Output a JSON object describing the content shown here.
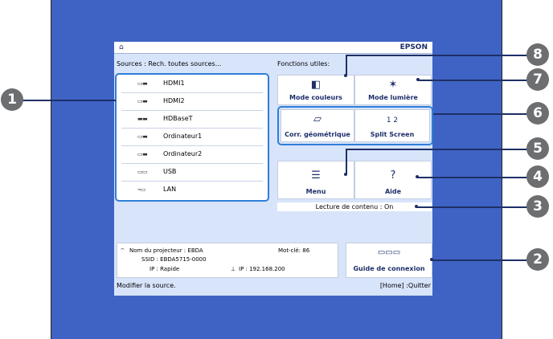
{
  "header": {
    "home_icon": "⌂",
    "brand": "EPSON"
  },
  "sources": {
    "heading": "Sources : Rech. toutes sources...",
    "items": [
      {
        "icon": "▭▬",
        "label": "HDMI1"
      },
      {
        "icon": "▭▬",
        "label": "HDMI2"
      },
      {
        "icon": "▬▬",
        "label": "HDBaseT"
      },
      {
        "icon": "▭▬",
        "label": "Ordinateur1"
      },
      {
        "icon": "▭▬",
        "label": "Ordinateur2"
      },
      {
        "icon": "▭▭",
        "label": "USB"
      },
      {
        "icon": "⌁▭",
        "label": "LAN"
      }
    ]
  },
  "functions": {
    "heading": "Fonctions utiles:",
    "color_mode": {
      "icon": "◧",
      "label": "Mode couleurs"
    },
    "light_mode": {
      "icon": "✶",
      "label": "Mode lumière"
    },
    "geometry": {
      "icon": "▱",
      "label": "Corr. géométrique"
    },
    "split": {
      "icon": "1 2",
      "label": "Split Screen"
    },
    "menu": {
      "icon": "☰",
      "label": "Menu"
    },
    "help": {
      "icon": "?",
      "label": "Aide"
    }
  },
  "content_playback": "Lecture de contenu : On",
  "info": {
    "projector_name": "Nom du projecteur : EBDA",
    "keyword": "Mot-clé: 86",
    "ssid": "SSID : EBDA5715-0000",
    "ip_mode": "IP : Rapide",
    "ip": "IP : 192.168.200",
    "wifi_icon": "⌔",
    "lan_icon": "⊥"
  },
  "guide": {
    "icon": "▭▭▭",
    "label": "Guide de connexion"
  },
  "footer": {
    "left": "Modifier la source.",
    "right": "[Home] :Quitter"
  },
  "callouts": [
    "1",
    "2",
    "3",
    "4",
    "5",
    "6",
    "7",
    "8"
  ],
  "colors": {
    "screen": "#3f63c4",
    "panel": "#d8e4fa",
    "highlight": "#2e7fd8",
    "callout": "#6d6e70"
  }
}
